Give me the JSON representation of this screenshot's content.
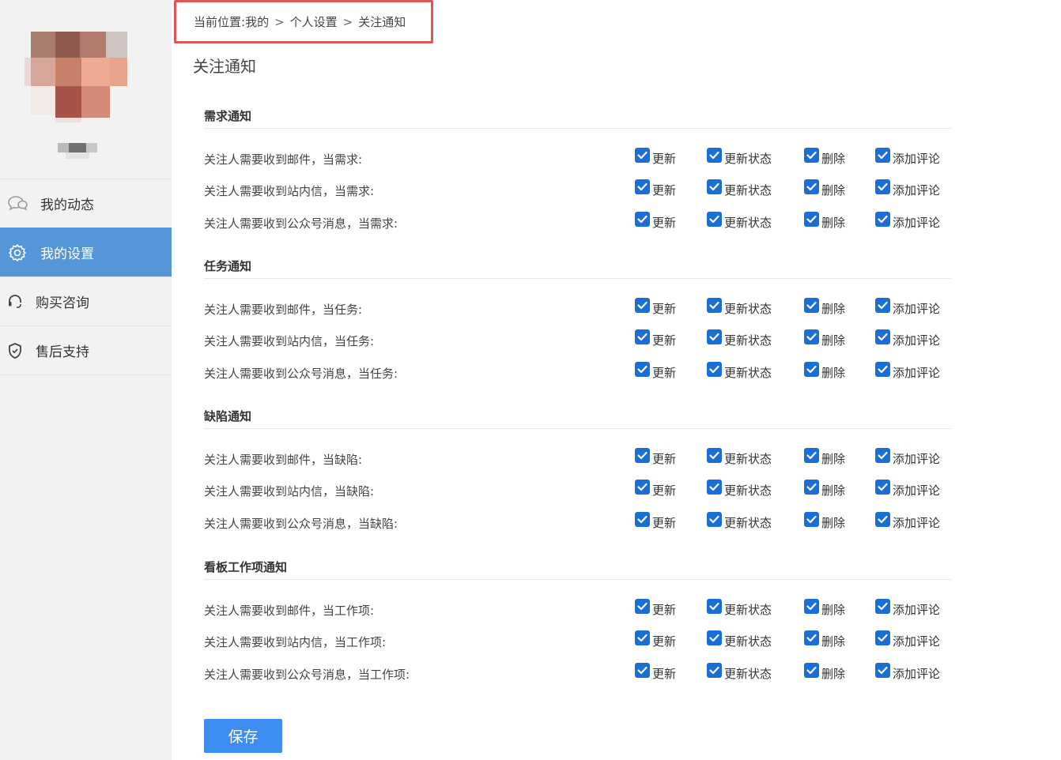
{
  "breadcrumb": {
    "prefix": "当前位置:",
    "items": [
      "我的",
      "个人设置",
      "关注通知"
    ],
    "separator": ">"
  },
  "page_title": "关注通知",
  "sidebar": {
    "items": [
      {
        "label": "我的动态",
        "icon": "chat-bubbles-icon",
        "active": false
      },
      {
        "label": "我的设置",
        "icon": "gear-icon",
        "active": true
      },
      {
        "label": "购买咨询",
        "icon": "headset-icon",
        "active": false
      },
      {
        "label": "售后支持",
        "icon": "shield-icon",
        "active": false
      }
    ]
  },
  "option_labels": [
    "更新",
    "更新状态",
    "删除",
    "添加评论"
  ],
  "sections": [
    {
      "title": "需求通知",
      "rows": [
        {
          "label": "关注人需要收到邮件，当需求:",
          "checked": [
            true,
            true,
            true,
            true
          ]
        },
        {
          "label": "关注人需要收到站内信，当需求:",
          "checked": [
            true,
            true,
            true,
            true
          ]
        },
        {
          "label": "关注人需要收到公众号消息，当需求:",
          "checked": [
            true,
            true,
            true,
            true
          ]
        }
      ]
    },
    {
      "title": "任务通知",
      "rows": [
        {
          "label": "关注人需要收到邮件，当任务:",
          "checked": [
            true,
            true,
            true,
            true
          ]
        },
        {
          "label": "关注人需要收到站内信，当任务:",
          "checked": [
            true,
            true,
            true,
            true
          ]
        },
        {
          "label": "关注人需要收到公众号消息，当任务:",
          "checked": [
            true,
            true,
            true,
            true
          ]
        }
      ]
    },
    {
      "title": "缺陷通知",
      "rows": [
        {
          "label": "关注人需要收到邮件，当缺陷:",
          "checked": [
            true,
            true,
            true,
            true
          ]
        },
        {
          "label": "关注人需要收到站内信，当缺陷:",
          "checked": [
            true,
            true,
            true,
            true
          ]
        },
        {
          "label": "关注人需要收到公众号消息，当缺陷:",
          "checked": [
            true,
            true,
            true,
            true
          ]
        }
      ]
    },
    {
      "title": "看板工作项通知",
      "rows": [
        {
          "label": "关注人需要收到邮件，当工作项:",
          "checked": [
            true,
            true,
            true,
            true
          ]
        },
        {
          "label": "关注人需要收到站内信，当工作项:",
          "checked": [
            true,
            true,
            true,
            true
          ]
        },
        {
          "label": "关注人需要收到公众号消息，当工作项:",
          "checked": [
            true,
            true,
            true,
            true
          ]
        }
      ]
    }
  ],
  "save_label": "保存",
  "colors": {
    "accent": "#5596d8",
    "checkbox": "#1a6fd6",
    "button": "#3d8ef0",
    "highlight_border": "#e25555"
  }
}
